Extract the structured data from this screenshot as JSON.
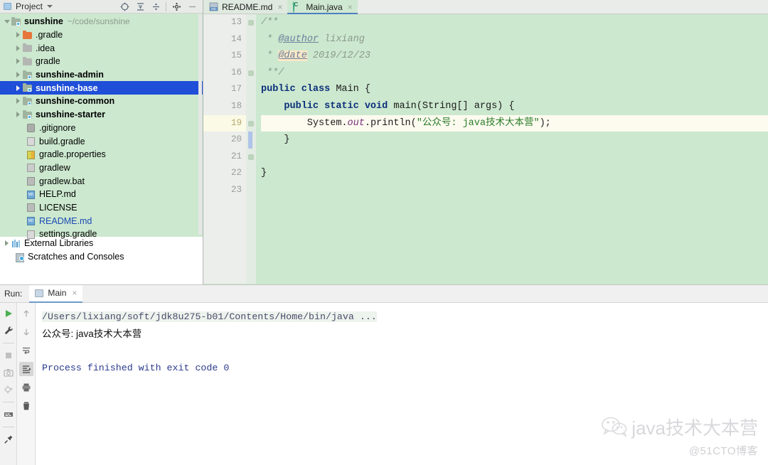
{
  "project_panel": {
    "title": "Project",
    "icon": "project-icon",
    "caret": "chevron-down-icon",
    "toolbar": [
      {
        "name": "locate-icon",
        "glyph": "⊕"
      },
      {
        "name": "expand-all-icon",
        "glyph": "≡"
      },
      {
        "name": "collapse-all-icon",
        "glyph": "÷"
      },
      {
        "name": "settings-gear-icon",
        "glyph": "⚙"
      },
      {
        "name": "hide-panel-icon",
        "glyph": "−"
      }
    ],
    "tree": [
      {
        "label": "sunshine",
        "path": "~/code/sunshine",
        "kind": "module-root",
        "arrow": "expanded",
        "depth": 0,
        "bold": true
      },
      {
        "label": ".gradle",
        "path": "",
        "kind": "folder-orange",
        "arrow": "collapsed",
        "depth": 1,
        "bold": false
      },
      {
        "label": ".idea",
        "path": "",
        "kind": "folder-gray",
        "arrow": "collapsed",
        "depth": 1,
        "bold": false
      },
      {
        "label": "gradle",
        "path": "",
        "kind": "folder-gray",
        "arrow": "collapsed",
        "depth": 1,
        "bold": false
      },
      {
        "label": "sunshine-admin",
        "path": "",
        "kind": "module",
        "arrow": "collapsed",
        "depth": 1,
        "bold": true
      },
      {
        "label": "sunshine-base",
        "path": "",
        "kind": "module",
        "arrow": "collapsed",
        "depth": 1,
        "bold": true,
        "selected": true
      },
      {
        "label": "sunshine-common",
        "path": "",
        "kind": "module",
        "arrow": "collapsed",
        "depth": 1,
        "bold": true
      },
      {
        "label": "sunshine-starter",
        "path": "",
        "kind": "module",
        "arrow": "collapsed",
        "depth": 1,
        "bold": true
      },
      {
        "label": ".gitignore",
        "path": "",
        "kind": "file-git",
        "arrow": "none",
        "depth": 1,
        "bold": false
      },
      {
        "label": "build.gradle",
        "path": "",
        "kind": "file-gradle",
        "arrow": "none",
        "depth": 1,
        "bold": false
      },
      {
        "label": "gradle.properties",
        "path": "",
        "kind": "file-properties",
        "arrow": "none",
        "depth": 1,
        "bold": false
      },
      {
        "label": "gradlew",
        "path": "",
        "kind": "file-text",
        "arrow": "none",
        "depth": 1,
        "bold": false
      },
      {
        "label": "gradlew.bat",
        "path": "",
        "kind": "file-bat",
        "arrow": "none",
        "depth": 1,
        "bold": false
      },
      {
        "label": "HELP.md",
        "path": "",
        "kind": "file-md",
        "arrow": "none",
        "depth": 1,
        "bold": false
      },
      {
        "label": "LICENSE",
        "path": "",
        "kind": "file-text",
        "arrow": "none",
        "depth": 1,
        "bold": false
      },
      {
        "label": "README.md",
        "path": "",
        "kind": "file-md",
        "arrow": "none",
        "depth": 1,
        "bold": false,
        "blue": true
      },
      {
        "label": "settings.gradle",
        "path": "",
        "kind": "file-gradle",
        "arrow": "none",
        "depth": 1,
        "bold": false
      },
      {
        "label": "External Libraries",
        "path": "",
        "kind": "libraries",
        "arrow": "collapsed",
        "depth": 0,
        "bold": false
      },
      {
        "label": "Scratches and Consoles",
        "path": "",
        "kind": "scratches",
        "arrow": "none",
        "depth": 0,
        "bold": false
      }
    ]
  },
  "editor": {
    "tabs": [
      {
        "label": "README.md",
        "icon": "markdown-icon",
        "active": false,
        "close": "×"
      },
      {
        "label": "Main.java",
        "icon": "java-class-icon",
        "active": true,
        "close": "×"
      }
    ],
    "first_line_number": 13,
    "lines": [
      {
        "num": 13,
        "run_marker": false,
        "highlight": false,
        "fold": true,
        "tokens": [
          {
            "t": "comment",
            "s": "/**"
          }
        ]
      },
      {
        "num": 14,
        "run_marker": false,
        "highlight": false,
        "fold": false,
        "tokens": [
          {
            "t": "comment",
            "s": " * "
          },
          {
            "t": "tag",
            "s": "@author"
          },
          {
            "t": "comment",
            "s": " lixiang"
          }
        ]
      },
      {
        "num": 15,
        "run_marker": false,
        "highlight": false,
        "fold": false,
        "tokens": [
          {
            "t": "comment",
            "s": " * "
          },
          {
            "t": "taghl",
            "s": "@date"
          },
          {
            "t": "comment",
            "s": " 2019/12/23"
          }
        ]
      },
      {
        "num": 16,
        "run_marker": false,
        "highlight": false,
        "fold": true,
        "tokens": [
          {
            "t": "comment",
            "s": " **/"
          }
        ]
      },
      {
        "num": 17,
        "run_marker": true,
        "highlight": false,
        "fold": false,
        "tokens": [
          {
            "t": "kw",
            "s": "public class "
          },
          {
            "t": "plain",
            "s": "Main {"
          }
        ]
      },
      {
        "num": 18,
        "run_marker": true,
        "highlight": false,
        "fold": true,
        "tokens": [
          {
            "t": "plain",
            "s": "    "
          },
          {
            "t": "kw",
            "s": "public static void "
          },
          {
            "t": "plain",
            "s": "main(String[] args) {"
          }
        ]
      },
      {
        "num": 19,
        "run_marker": false,
        "highlight": true,
        "fold": false,
        "caret": true,
        "tokens": [
          {
            "t": "plain",
            "s": "        System."
          },
          {
            "t": "field",
            "s": "out"
          },
          {
            "t": "plain",
            "s": ".println("
          },
          {
            "t": "str",
            "s": "\"公众号: java技术大本营\""
          },
          {
            "t": "plain",
            "s": ");"
          }
        ]
      },
      {
        "num": 20,
        "run_marker": false,
        "highlight": false,
        "fold": true,
        "tokens": [
          {
            "t": "plain",
            "s": "    }"
          }
        ]
      },
      {
        "num": 21,
        "run_marker": false,
        "highlight": false,
        "fold": false,
        "tokens": [
          {
            "t": "plain",
            "s": ""
          }
        ]
      },
      {
        "num": 22,
        "run_marker": false,
        "highlight": false,
        "fold": false,
        "tokens": [
          {
            "t": "plain",
            "s": "}"
          }
        ]
      },
      {
        "num": 23,
        "run_marker": false,
        "highlight": false,
        "fold": false,
        "tokens": [
          {
            "t": "plain",
            "s": ""
          }
        ]
      }
    ]
  },
  "run_panel": {
    "label": "Run:",
    "tab": {
      "label": "Main",
      "icon": "run-config-icon",
      "close": "×"
    },
    "toolbar_left": [
      {
        "name": "rerun-icon",
        "glyph": "▶"
      },
      {
        "name": "wrench-settings-icon",
        "glyph": "🔧"
      },
      {
        "name": "stop-icon",
        "glyph": "■"
      },
      {
        "name": "camera-snapshot-icon",
        "glyph": "◎"
      },
      {
        "name": "coverage-icon",
        "glyph": "⚙"
      },
      {
        "name": "console-view-icon",
        "glyph": "⌸"
      },
      {
        "name": "pin-tab-icon",
        "glyph": "📌"
      }
    ],
    "toolbar_right": [
      {
        "name": "scroll-up-icon",
        "glyph": "↑"
      },
      {
        "name": "scroll-down-icon",
        "glyph": "↓"
      },
      {
        "name": "soft-wrap-icon",
        "glyph": "↵"
      },
      {
        "name": "scroll-to-end-icon",
        "glyph": "⇥",
        "active": true
      },
      {
        "name": "print-icon",
        "glyph": "⎙"
      },
      {
        "name": "clear-all-icon",
        "glyph": "🗑"
      }
    ],
    "console": [
      {
        "type": "command",
        "text": "/Users/lixiang/soft/jdk8u275-b01/Contents/Home/bin/java ..."
      },
      {
        "type": "output",
        "text": "公众号: java技术大本营"
      },
      {
        "type": "blank",
        "text": ""
      },
      {
        "type": "finished",
        "text": "Process finished with exit code 0"
      }
    ]
  },
  "watermark": {
    "icon": "wechat-icon",
    "text": "java技术大本营",
    "sub": "@51CTO博客"
  },
  "colors": {
    "editor_bg": "#cce8cf",
    "selection_blue": "#1f4ed8",
    "highlight_line": "#fdfbef",
    "keyword": "#0b2f7a",
    "string": "#2a7d2a",
    "finished_text": "#2b3a8c"
  }
}
